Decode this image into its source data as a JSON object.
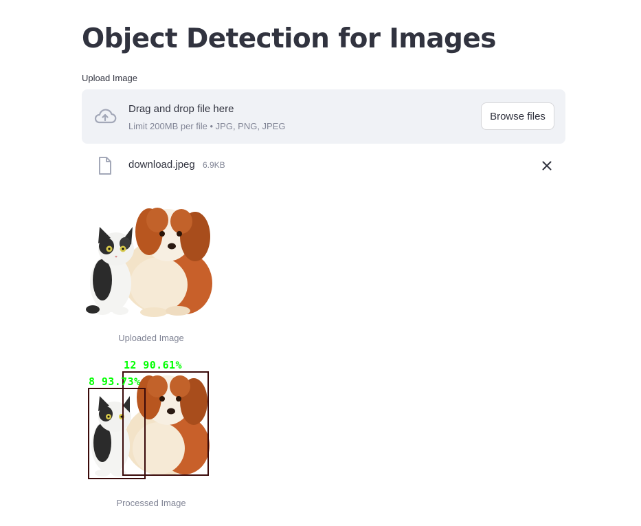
{
  "page": {
    "title": "Object Detection for Images"
  },
  "uploader": {
    "label": "Upload Image",
    "drop_title": "Drag and drop file here",
    "drop_subtitle": "Limit 200MB per file • JPG, PNG, JPEG",
    "browse_label": "Browse files",
    "icon": "cloud-upload-icon"
  },
  "uploaded_file": {
    "name": "download.jpeg",
    "size": "6.9KB",
    "icon": "file-icon",
    "remove_icon": "close-icon"
  },
  "images": {
    "uploaded_caption": "Uploaded Image",
    "processed_caption": "Processed Image"
  },
  "detections": [
    {
      "label": "12 90.61%"
    },
    {
      "label": "8 93.73%"
    }
  ],
  "colors": {
    "accent_box": "#3a0a0a",
    "label_green": "#00ff00",
    "dropzone_bg": "#f0f2f6",
    "text": "#31333f",
    "muted": "#808495"
  }
}
